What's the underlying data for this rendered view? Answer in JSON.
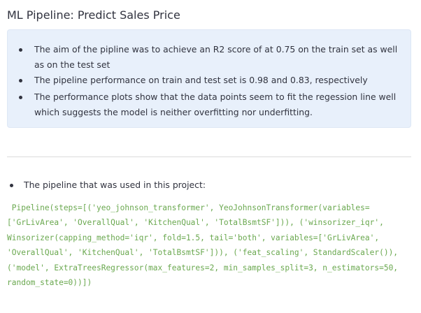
{
  "title": "ML Pipeline: Predict Sales Price",
  "info_box": {
    "items": [
      "The aim of the pipline was to achieve an R2 score of at 0.75 on the train set as well as on the test set",
      "The pipeline performance on train and test set is 0.98 and 0.83, respectively",
      "The performance plots show that the data points seem to fit the regession line well which suggests the model is neither overfitting nor underfitting."
    ],
    "background": "#e8f0fb"
  },
  "pipeline_label": "The pipeline that was used in this project:",
  "code": {
    "lines": [
      " Pipeline(steps=[('yeo_johnson_transformer', YeoJohnsonTransformer(variables=",
      "['GrLivArea', 'OverallQual', 'KitchenQual', 'TotalBsmtSF'])), ('winsorizer_iqr',",
      "Winsorizer(capping_method='iqr', fold=1.5, tail='both', variables=['GrLivArea',",
      "'OverallQual', 'KitchenQual', 'TotalBsmtSF'])), ('feat_scaling', StandardScaler()),",
      "('model', ExtraTreesRegressor(max_features=2, min_samples_split=3, n_estimators=50,",
      "random_state=0))])"
    ],
    "color": "#6aa84f"
  }
}
